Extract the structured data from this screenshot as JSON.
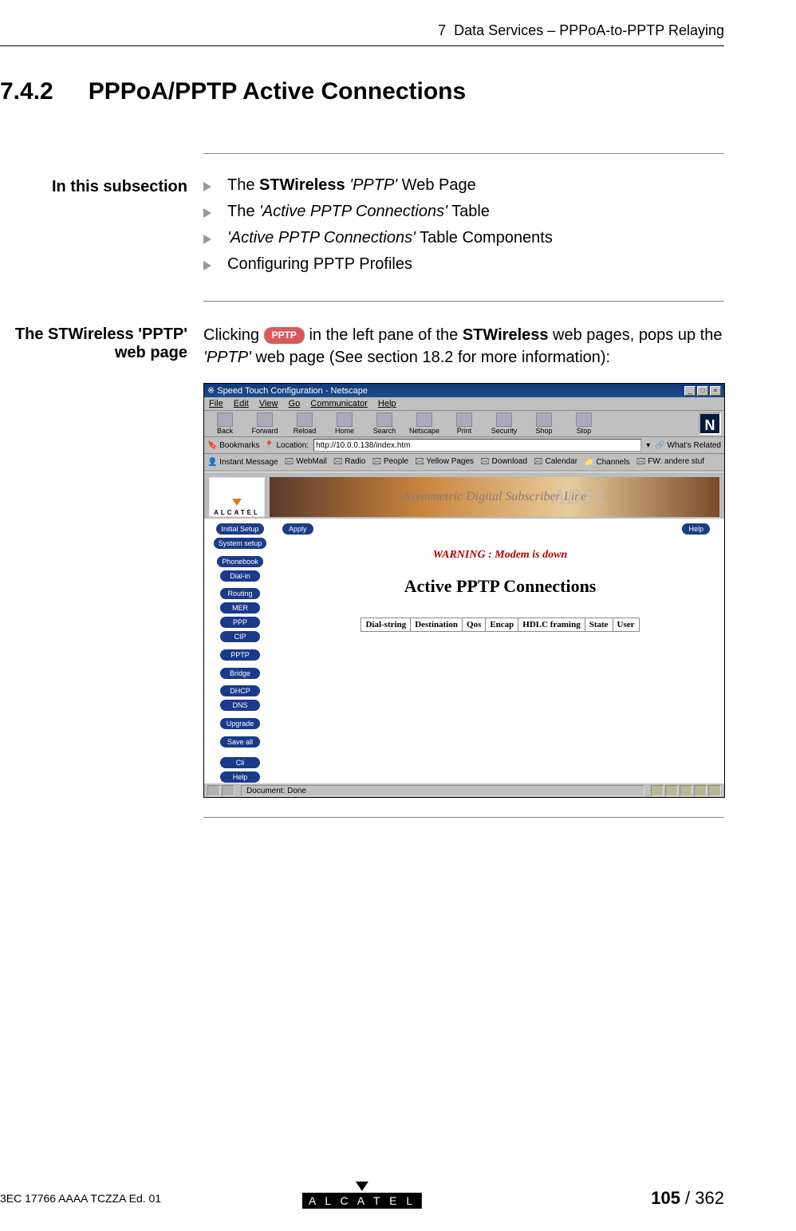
{
  "header": {
    "chapter": "7",
    "chapter_title": "Data Services – PPPoA-to-PPTP Relaying"
  },
  "section": {
    "number": "7.4.2",
    "title": "PPPoA/PPTP Active Connections"
  },
  "subsection": {
    "label": "In this subsection",
    "items": [
      {
        "pre": "The ",
        "bold": "STWireless",
        "post_italic": " 'PPTP'",
        "post": " Web Page"
      },
      {
        "text": "The 'Active PPTP Connections' Table",
        "italic_part": "'Active PPTP Connections'"
      },
      {
        "text": "'Active PPTP Connections' Table Components",
        "italic_part": "'Active PPTP Connections'"
      },
      {
        "text": "Configuring PPTP Profiles"
      }
    ]
  },
  "stw": {
    "label_line1": "The STWireless 'PPTP'",
    "label_line2": "web page",
    "para_pre": "Clicking ",
    "pill": "PPTP",
    "para_mid1": " in the left pane of the ",
    "bold": "STWireless",
    "para_mid2": " web pages, pops up the ",
    "italic": "'PPTP'",
    "para_end": " web page (See section 18.2 for more information):"
  },
  "netscape": {
    "title": "Speed Touch Configuration - Netscape",
    "menus": [
      "File",
      "Edit",
      "View",
      "Go",
      "Communicator",
      "Help"
    ],
    "toolbar": [
      "Back",
      "Forward",
      "Reload",
      "Home",
      "Search",
      "Netscape",
      "Print",
      "Security",
      "Shop",
      "Stop"
    ],
    "bookmarks_label": "Bookmarks",
    "location_label": "Location:",
    "location_value": "http://10.0.0.138/index.htm",
    "whats_related": "What's Related",
    "linkbar": [
      "Instant Message",
      "WebMail",
      "Radio",
      "People",
      "Yellow Pages",
      "Download",
      "Calendar",
      "Channels",
      "FW: andere stuf"
    ],
    "alcatel": "ALCATEL",
    "adsl_tagline": "Asymmetric Digital Subscriber Line",
    "adsl": "ADSL",
    "nav": [
      "Initial Setup",
      "System setup",
      "Phonebook",
      "Dial-in",
      "Routing",
      "MER",
      "PPP",
      "CIP",
      "PPTP",
      "Bridge",
      "DHCP",
      "DNS",
      "Upgrade",
      "Save all",
      "Cli",
      "Help"
    ],
    "apply": "Apply",
    "help": "Help",
    "warning": "WARNING : Modem is down",
    "main_title": "Active PPTP Connections",
    "columns": [
      "Dial-string",
      "Destination",
      "Qos",
      "Encap",
      "HDLC framing",
      "State",
      "User"
    ],
    "status": "Document: Done"
  },
  "footer": {
    "left": "3EC 17766 AAAA TCZZA Ed. 01",
    "logo": "A L C A T E L",
    "page": "105",
    "total": "362"
  }
}
